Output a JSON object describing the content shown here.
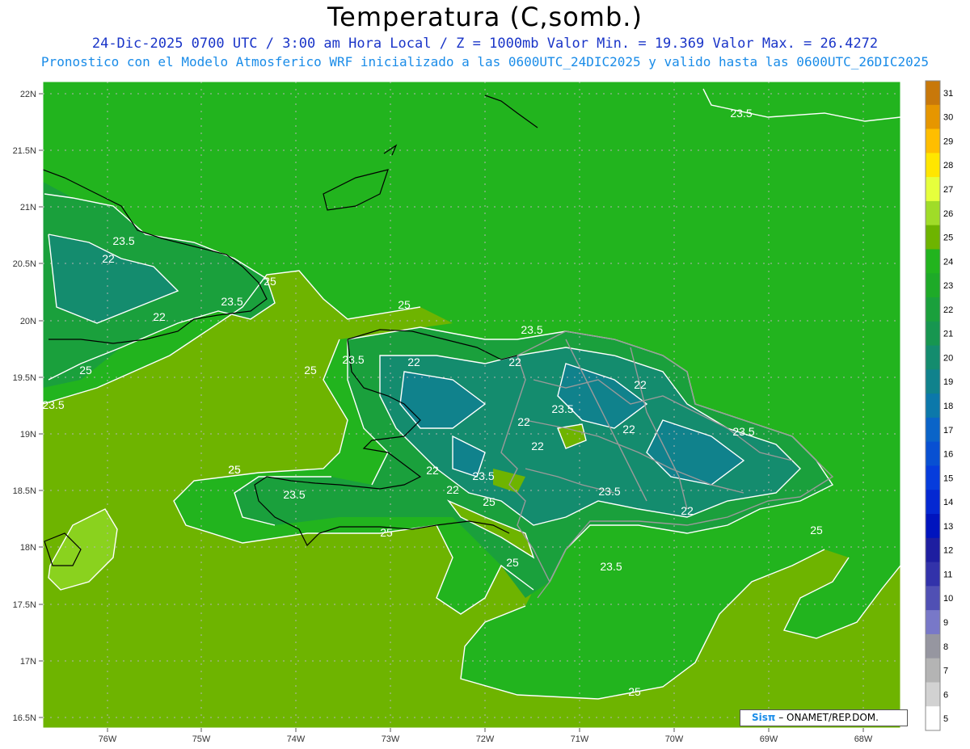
{
  "header": {
    "title": "Temperatura (C,somb.)",
    "line1": "24-Dic-2025  0700 UTC / 3:00 am Hora Local / Z = 1000mb    Valor Min. = 19.369  Valor Max. = 26.4272",
    "line2": "Pronostico con el Modelo Atmosferico WRF inicializado a las 0600UTC_24DIC2025 y valido hasta las  0600UTC_26DIC2025"
  },
  "axes": {
    "lat_labels": [
      "22N",
      "21.5N",
      "21N",
      "20.5N",
      "20N",
      "19.5N",
      "19N",
      "18.5N",
      "18N",
      "17.5N",
      "17N",
      "16.5N"
    ],
    "lon_labels": [
      "76W",
      "75W",
      "74W",
      "73W",
      "72W",
      "71W",
      "70W",
      "69W",
      "68W"
    ]
  },
  "legend": {
    "values": [
      "31",
      "30",
      "29",
      "28",
      "27",
      "26",
      "25",
      "24",
      "23",
      "22",
      "21",
      "20",
      "19",
      "18",
      "17",
      "16",
      "15",
      "14",
      "13",
      "12",
      "11",
      "10",
      "9",
      "8",
      "7",
      "6",
      "5"
    ],
    "colors": [
      "#c8780a",
      "#e69600",
      "#ffbe00",
      "#ffe600",
      "#e6ff3c",
      "#a0dc28",
      "#6eb400",
      "#22b41e",
      "#1eaa28",
      "#1aa03c",
      "#179650",
      "#148c6e",
      "#10828c",
      "#0c78aa",
      "#0a64c8",
      "#0850d2",
      "#063cdc",
      "#0428d2",
      "#0014be",
      "#1e1ea0",
      "#3232aa",
      "#5050b4",
      "#7878c8",
      "#9696a0",
      "#b4b4b4",
      "#d2d2d2",
      "#ffffff"
    ]
  },
  "contours": {
    "labels": [
      "23.5",
      "23.5",
      "22",
      "25",
      "23.5",
      "22",
      "25",
      "23.5",
      "25",
      "23.5",
      "22",
      "22",
      "23.5",
      "22",
      "22",
      "22",
      "22",
      "22",
      "23.5",
      "25",
      "23.5",
      "22",
      "25",
      "25",
      "25",
      "23.5",
      "25",
      "23.5",
      "22",
      "25",
      "23.5",
      "25",
      "25",
      "23.5"
    ]
  },
  "credit": {
    "brand": "Sisπ",
    "text": "– ONAMET/REP.DOM."
  }
}
